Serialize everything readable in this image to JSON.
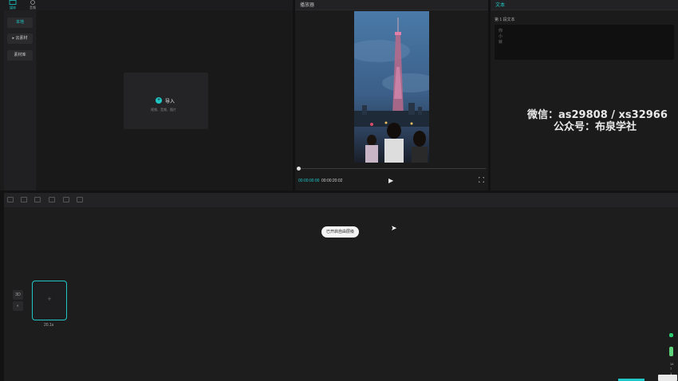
{
  "media": {
    "tabs": [
      {
        "label": "媒体",
        "icon": "media-icon"
      },
      {
        "label": "音频",
        "icon": "audio-icon"
      }
    ],
    "sidebar": [
      {
        "label": "本地"
      },
      {
        "label": "▸ 云素材"
      },
      {
        "label": "素材库"
      }
    ],
    "import": {
      "label": "导入",
      "hint": "视频、音频、图片"
    }
  },
  "player": {
    "title": "播放器",
    "time_current": "00:00:00:00",
    "time_total": "00:00:20:02"
  },
  "text_panel": {
    "title": "文本",
    "subtitle": "第 1 段文本",
    "lines": [
      "你",
      "小",
      "就"
    ]
  },
  "watermark": {
    "line1": "微信：as29808 / xs32966",
    "line2": "公众号：布泉学社"
  },
  "timeline": {
    "toast": "已开启自由层级",
    "clip_duration": "20.1s",
    "track_label": "3D",
    "right_numbers": [
      "14",
      "7",
      "1"
    ]
  },
  "colors": {
    "accent": "#1fc7c7",
    "panel": "#1b1b1c",
    "background": "#121212"
  }
}
